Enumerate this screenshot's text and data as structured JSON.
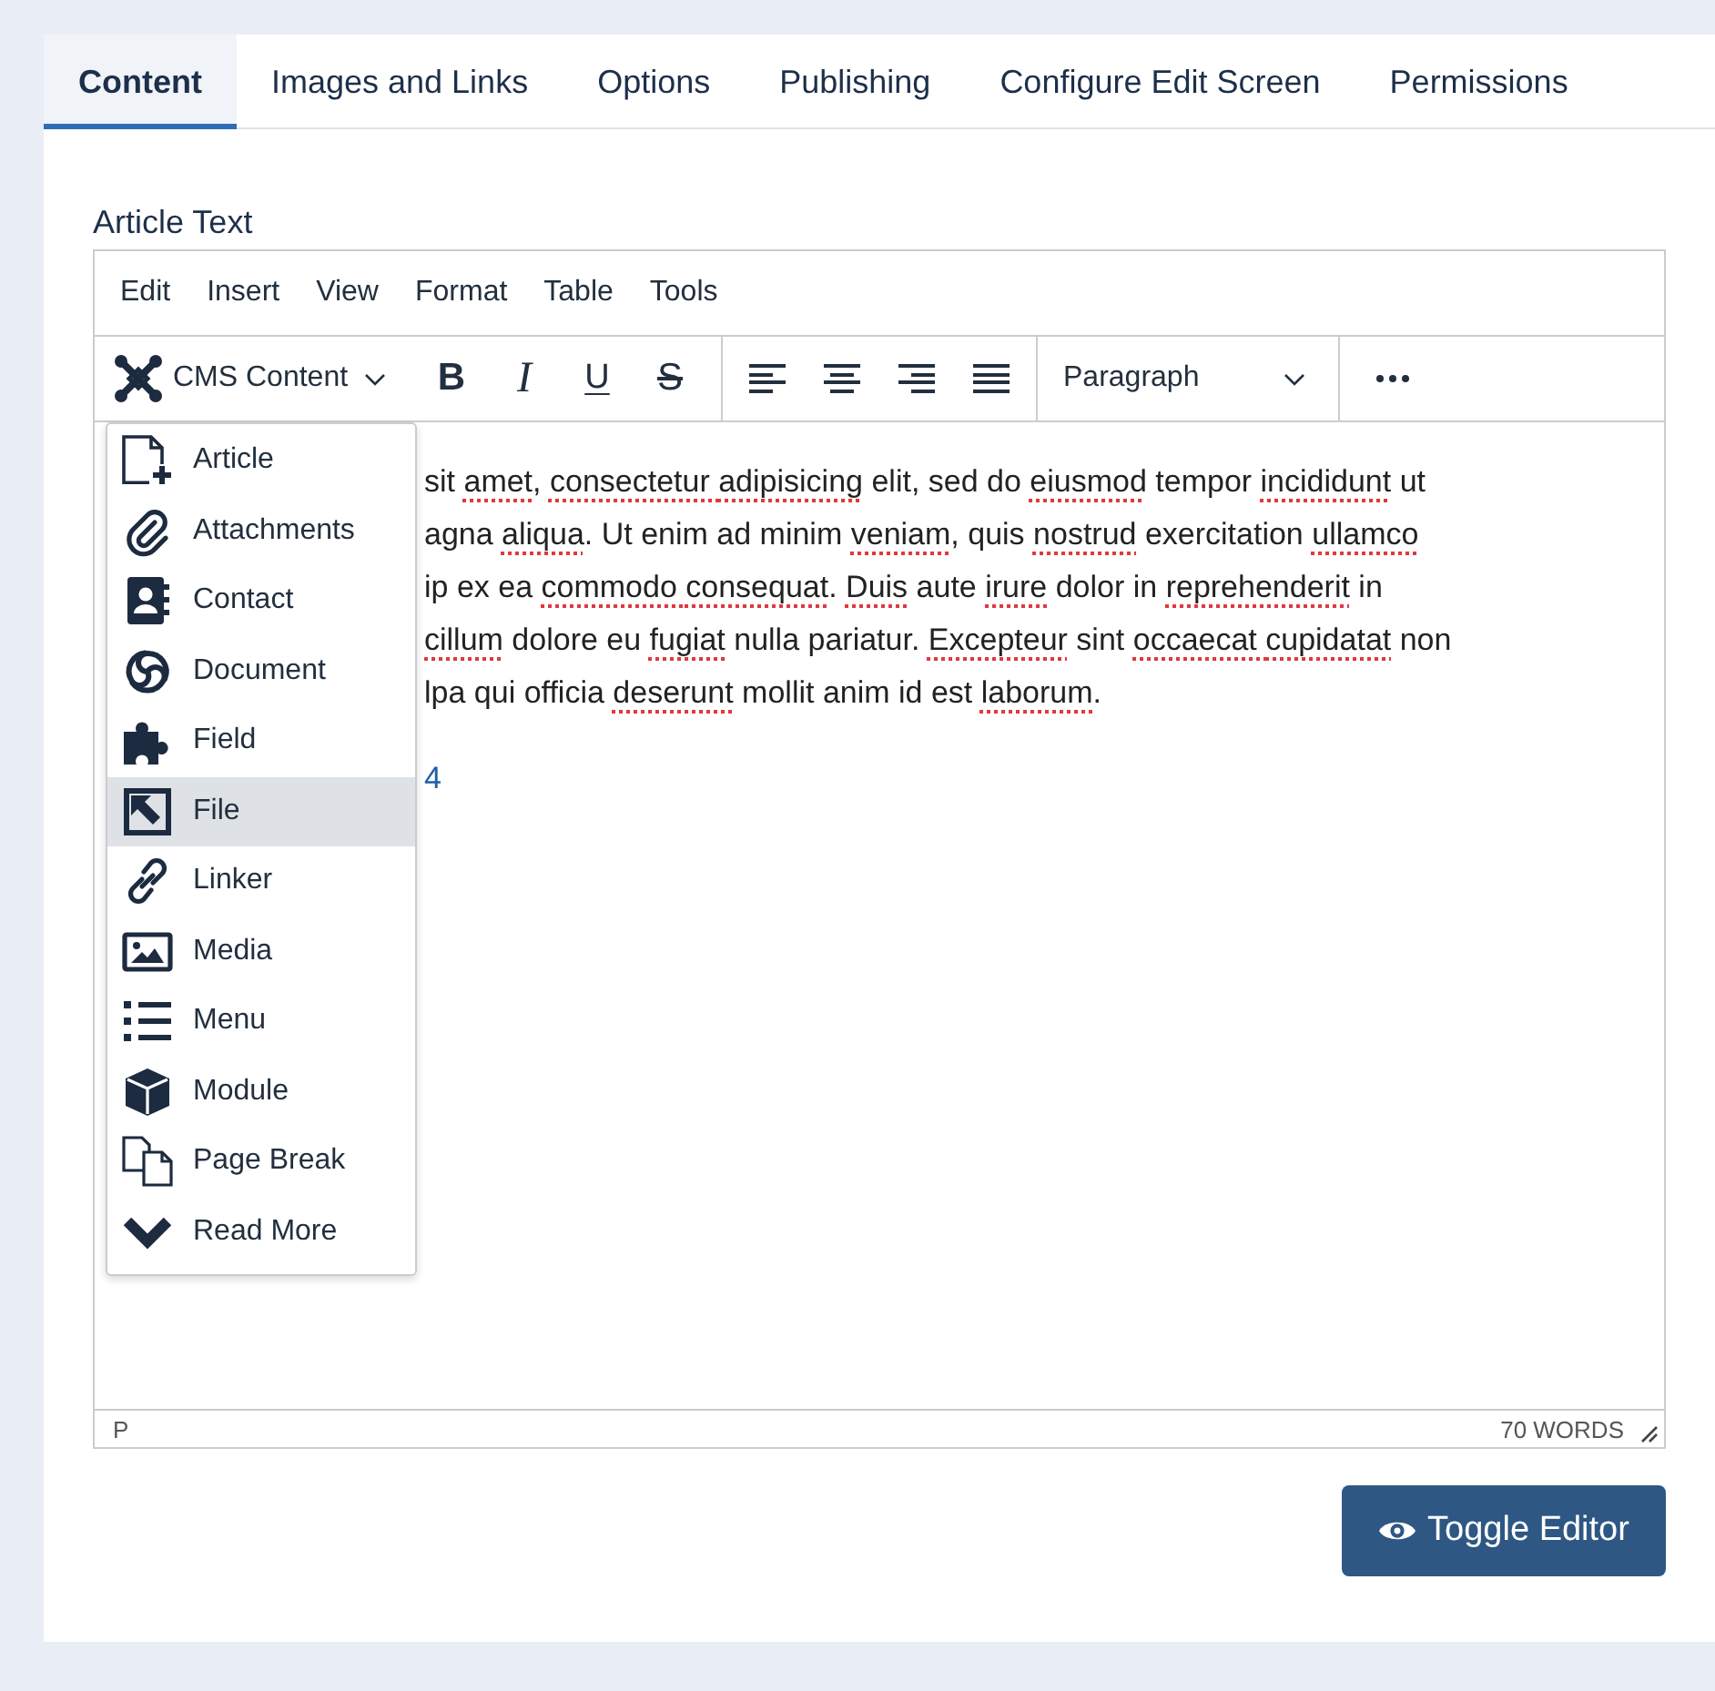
{
  "tabs": [
    {
      "label": "Content",
      "selected": true
    },
    {
      "label": "Images and Links",
      "selected": false
    },
    {
      "label": "Options",
      "selected": false
    },
    {
      "label": "Publishing",
      "selected": false
    },
    {
      "label": "Configure Edit Screen",
      "selected": false
    },
    {
      "label": "Permissions",
      "selected": false
    }
  ],
  "field": {
    "label": "Article Text"
  },
  "editor": {
    "menu_bar": [
      "Edit",
      "Insert",
      "View",
      "Format",
      "Table",
      "Tools"
    ],
    "toolbar": {
      "plugin_button": {
        "label": "CMS Content"
      },
      "format_buttons": [
        {
          "kind": "bold",
          "glyph": "B"
        },
        {
          "kind": "italic",
          "glyph": "I"
        },
        {
          "kind": "underline",
          "glyph": "U"
        },
        {
          "kind": "strikethrough",
          "glyph": "S"
        }
      ],
      "block_format": {
        "value": "Paragraph"
      }
    },
    "plugin_menu": {
      "items": [
        {
          "label": "Article",
          "selected": false
        },
        {
          "label": "Attachments",
          "selected": false
        },
        {
          "label": "Contact",
          "selected": false
        },
        {
          "label": "Document",
          "selected": false
        },
        {
          "label": "Field",
          "selected": false
        },
        {
          "label": "File",
          "selected": true
        },
        {
          "label": "Linker",
          "selected": false
        },
        {
          "label": "Media",
          "selected": false
        },
        {
          "label": "Menu",
          "selected": false
        },
        {
          "label": "Module",
          "selected": false
        },
        {
          "label": "Page Break",
          "selected": false
        },
        {
          "label": "Read More",
          "selected": false
        }
      ]
    },
    "content": {
      "lines": [
        {
          "segments": [
            {
              "text": "sit ",
              "flagged": false
            },
            {
              "text": "amet",
              "flagged": true
            },
            {
              "text": ", ",
              "flagged": false
            },
            {
              "text": "consectetur ",
              "flagged": true
            },
            {
              "text": "adipisicing",
              "flagged": true
            },
            {
              "text": " elit, sed do ",
              "flagged": false
            },
            {
              "text": "eiusmod",
              "flagged": true
            },
            {
              "text": " tempor ",
              "flagged": false
            },
            {
              "text": "incididunt",
              "flagged": true
            },
            {
              "text": " ut",
              "flagged": false
            }
          ]
        },
        {
          "segments": [
            {
              "text": "agna ",
              "flagged": false
            },
            {
              "text": "aliqua",
              "flagged": true
            },
            {
              "text": ". Ut enim ad minim ",
              "flagged": false
            },
            {
              "text": "veniam",
              "flagged": true
            },
            {
              "text": ", quis ",
              "flagged": false
            },
            {
              "text": "nostrud",
              "flagged": true
            },
            {
              "text": " exercitation ",
              "flagged": false
            },
            {
              "text": "ullamco",
              "flagged": true
            }
          ]
        },
        {
          "segments": [
            {
              "text": "ip ex ea ",
              "flagged": false
            },
            {
              "text": "commodo ",
              "flagged": true
            },
            {
              "text": "consequat",
              "flagged": true
            },
            {
              "text": ". ",
              "flagged": false
            },
            {
              "text": "Duis",
              "flagged": true
            },
            {
              "text": " aute ",
              "flagged": false
            },
            {
              "text": "irure",
              "flagged": true
            },
            {
              "text": " dolor in ",
              "flagged": false
            },
            {
              "text": "reprehenderit",
              "flagged": true
            },
            {
              "text": " in",
              "flagged": false
            }
          ]
        },
        {
          "segments": [
            {
              "text": "cillum",
              "flagged": true
            },
            {
              "text": " dolore eu ",
              "flagged": false
            },
            {
              "text": "fugiat",
              "flagged": true
            },
            {
              "text": " nulla pariatur. ",
              "flagged": false
            },
            {
              "text": "Excepteur",
              "flagged": true
            },
            {
              "text": " sint ",
              "flagged": false
            },
            {
              "text": "occaecat ",
              "flagged": true
            },
            {
              "text": "cupidatat",
              "flagged": true
            },
            {
              "text": " non",
              "flagged": false
            }
          ]
        },
        {
          "segments": [
            {
              "text": "lpa qui officia ",
              "flagged": false
            },
            {
              "text": "deserunt",
              "flagged": true
            },
            {
              "text": " mollit anim id est ",
              "flagged": false
            },
            {
              "text": "laborum",
              "flagged": true
            },
            {
              "text": ".",
              "flagged": false
            }
          ]
        }
      ],
      "link": {
        "text": "4"
      }
    },
    "status_bar": {
      "path": "P",
      "word_count": "70 WORDS"
    }
  },
  "toggle_button": {
    "label": "Toggle Editor"
  }
}
